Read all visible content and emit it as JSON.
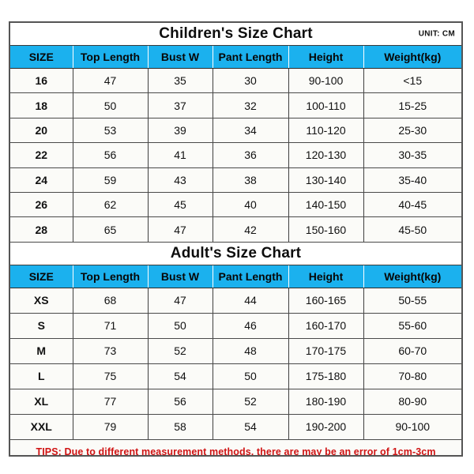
{
  "theme": {
    "header_bg": "#1bb1ee",
    "cell_bg": "#fbfbf8",
    "border": "#3a3a3a",
    "frame": "#555555",
    "text": "#111111",
    "tips_color": "#d01414",
    "page_bg": "#ffffff"
  },
  "columns": [
    "SIZE",
    "Top Length",
    "Bust W",
    "Pant Length",
    "Height",
    "Weight(kg)"
  ],
  "children": {
    "title": "Children's Size Chart",
    "unit": "UNIT: CM",
    "rows": [
      [
        "16",
        "47",
        "35",
        "30",
        "90-100",
        "<15"
      ],
      [
        "18",
        "50",
        "37",
        "32",
        "100-110",
        "15-25"
      ],
      [
        "20",
        "53",
        "39",
        "34",
        "110-120",
        "25-30"
      ],
      [
        "22",
        "56",
        "41",
        "36",
        "120-130",
        "30-35"
      ],
      [
        "24",
        "59",
        "43",
        "38",
        "130-140",
        "35-40"
      ],
      [
        "26",
        "62",
        "45",
        "40",
        "140-150",
        "40-45"
      ],
      [
        "28",
        "65",
        "47",
        "42",
        "150-160",
        "45-50"
      ]
    ]
  },
  "adults": {
    "title": "Adult's Size Chart",
    "rows": [
      [
        "XS",
        "68",
        "47",
        "44",
        "160-165",
        "50-55"
      ],
      [
        "S",
        "71",
        "50",
        "46",
        "160-170",
        "55-60"
      ],
      [
        "M",
        "73",
        "52",
        "48",
        "170-175",
        "60-70"
      ],
      [
        "L",
        "75",
        "54",
        "50",
        "175-180",
        "70-80"
      ],
      [
        "XL",
        "77",
        "56",
        "52",
        "180-190",
        "80-90"
      ],
      [
        "XXL",
        "79",
        "58",
        "54",
        "190-200",
        "90-100"
      ]
    ]
  },
  "tips": "TIPS: Due to different measurement methods, there are may be an error of 1cm-3cm"
}
